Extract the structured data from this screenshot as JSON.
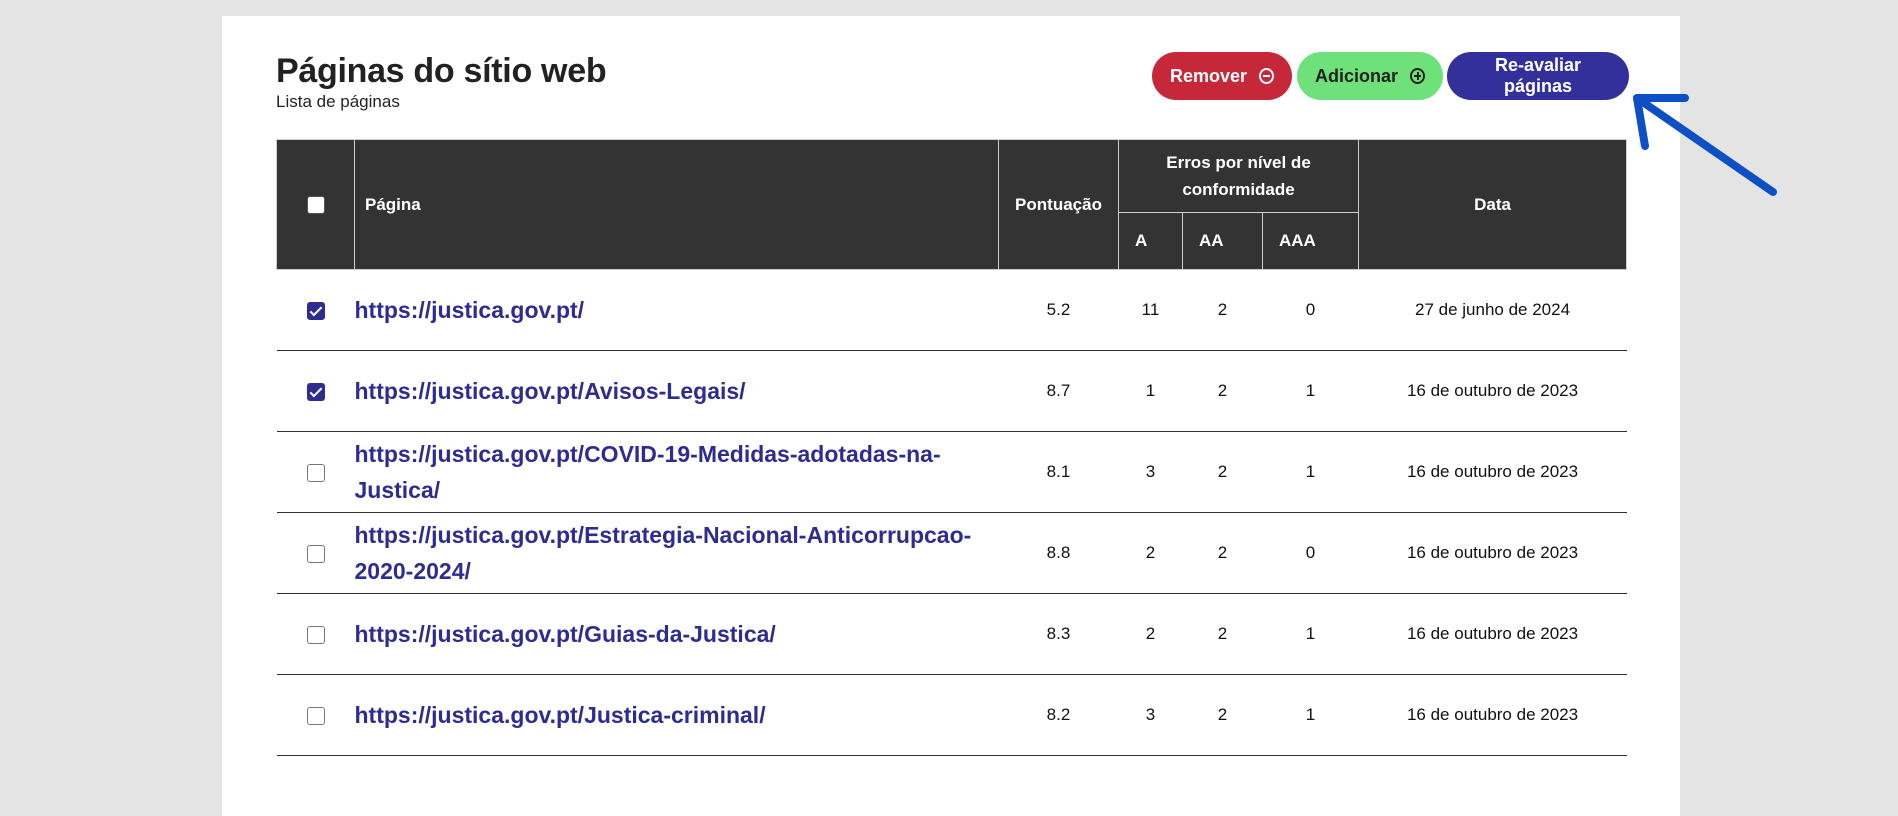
{
  "header": {
    "title": "Páginas do sítio web",
    "subtitle": "Lista de páginas"
  },
  "toolbar": {
    "remove_label": "Remover",
    "add_label": "Adicionar",
    "reevaluate_label": "Re-avaliar páginas"
  },
  "table": {
    "columns": {
      "page": "Página",
      "score": "Pontuação",
      "errors": "Erros por nível de conformidade",
      "level_a": "A",
      "level_aa": "AA",
      "level_aaa": "AAA",
      "date": "Data"
    },
    "rows": [
      {
        "checked": true,
        "url": "https://justica.gov.pt/",
        "score": "5.2",
        "a": "11",
        "aa": "2",
        "aaa": "0",
        "date": "27 de junho de 2024"
      },
      {
        "checked": true,
        "url": "https://justica.gov.pt/Avisos-Legais/",
        "score": "8.7",
        "a": "1",
        "aa": "2",
        "aaa": "1",
        "date": "16 de outubro de 2023"
      },
      {
        "checked": false,
        "url": "https://justica.gov.pt/COVID-19-Medidas-adotadas-na-Justica/",
        "score": "8.1",
        "a": "3",
        "aa": "2",
        "aaa": "1",
        "date": "16 de outubro de 2023"
      },
      {
        "checked": false,
        "url": "https://justica.gov.pt/Estrategia-Nacional-Anticorrupcao-2020-2024/",
        "score": "8.8",
        "a": "2",
        "aa": "2",
        "aaa": "0",
        "date": "16 de outubro de 2023"
      },
      {
        "checked": false,
        "url": "https://justica.gov.pt/Guias-da-Justica/",
        "score": "8.3",
        "a": "2",
        "aa": "2",
        "aaa": "1",
        "date": "16 de outubro de 2023"
      },
      {
        "checked": false,
        "url": "https://justica.gov.pt/Justica-criminal/",
        "score": "8.2",
        "a": "3",
        "aa": "2",
        "aaa": "1",
        "date": "16 de outubro de 2023"
      }
    ]
  },
  "colors": {
    "remove": "#c6283a",
    "add": "#6ee17a",
    "reevaluate": "#33309b",
    "link": "#2e2c91",
    "header_bg": "#333333",
    "arrow": "#0d4fc4"
  },
  "icons": {
    "remove": "minus-circle-icon",
    "add": "plus-circle-icon",
    "annotation": "arrow-annotation-icon"
  }
}
